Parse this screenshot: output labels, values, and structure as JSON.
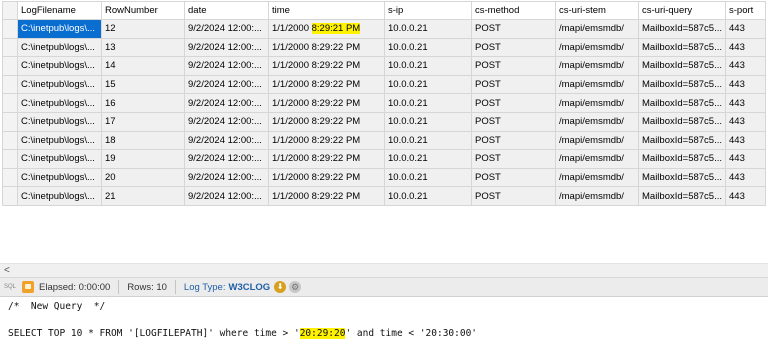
{
  "grid": {
    "columns": [
      "LogFilename",
      "RowNumber",
      "date",
      "time",
      "s-ip",
      "cs-method",
      "cs-uri-stem",
      "cs-uri-query",
      "s-port"
    ],
    "rows": [
      [
        "C:\\inetpub\\logs\\...",
        "12",
        "9/2/2024 12:00:...",
        "1/1/2000",
        "10.0.0.21",
        "POST",
        "/mapi/emsmdb/",
        "MailboxId=587c5...",
        "443"
      ],
      [
        "C:\\inetpub\\logs\\...",
        "13",
        "9/2/2024 12:00:...",
        "1/1/2000 8:29:22 PM",
        "10.0.0.21",
        "POST",
        "/mapi/emsmdb/",
        "MailboxId=587c5...",
        "443"
      ],
      [
        "C:\\inetpub\\logs\\...",
        "14",
        "9/2/2024 12:00:...",
        "1/1/2000 8:29:22 PM",
        "10.0.0.21",
        "POST",
        "/mapi/emsmdb/",
        "MailboxId=587c5...",
        "443"
      ],
      [
        "C:\\inetpub\\logs\\...",
        "15",
        "9/2/2024 12:00:...",
        "1/1/2000 8:29:22 PM",
        "10.0.0.21",
        "POST",
        "/mapi/emsmdb/",
        "MailboxId=587c5...",
        "443"
      ],
      [
        "C:\\inetpub\\logs\\...",
        "16",
        "9/2/2024 12:00:...",
        "1/1/2000 8:29:22 PM",
        "10.0.0.21",
        "POST",
        "/mapi/emsmdb/",
        "MailboxId=587c5...",
        "443"
      ],
      [
        "C:\\inetpub\\logs\\...",
        "17",
        "9/2/2024 12:00:...",
        "1/1/2000 8:29:22 PM",
        "10.0.0.21",
        "POST",
        "/mapi/emsmdb/",
        "MailboxId=587c5...",
        "443"
      ],
      [
        "C:\\inetpub\\logs\\...",
        "18",
        "9/2/2024 12:00:...",
        "1/1/2000 8:29:22 PM",
        "10.0.0.21",
        "POST",
        "/mapi/emsmdb/",
        "MailboxId=587c5...",
        "443"
      ],
      [
        "C:\\inetpub\\logs\\...",
        "19",
        "9/2/2024 12:00:...",
        "1/1/2000 8:29:22 PM",
        "10.0.0.21",
        "POST",
        "/mapi/emsmdb/",
        "MailboxId=587c5...",
        "443"
      ],
      [
        "C:\\inetpub\\logs\\...",
        "20",
        "9/2/2024 12:00:...",
        "1/1/2000 8:29:22 PM",
        "10.0.0.21",
        "POST",
        "/mapi/emsmdb/",
        "MailboxId=587c5...",
        "443"
      ],
      [
        "C:\\inetpub\\logs\\...",
        "21",
        "9/2/2024 12:00:...",
        "1/1/2000 8:29:22 PM",
        "10.0.0.21",
        "POST",
        "/mapi/emsmdb/",
        "MailboxId=587c5...",
        "443"
      ]
    ],
    "first_row_time_highlight": "8:29:21 PM",
    "selected_cell_color": "#0a6ed1",
    "highlight_color": "#fff200"
  },
  "scrollbar": {
    "left_arrow": "<"
  },
  "status": {
    "sql_icon": "sql-icon",
    "elapsed": "Elapsed: 0:00:00",
    "rows": "Rows: 10",
    "log_type_label": "Log Type:",
    "log_type_value": "W3CLOG",
    "down_icon": "download-icon",
    "gear_icon": "gear-icon"
  },
  "editor": {
    "comment": "/*  New Query  */",
    "query_prefix": "SELECT TOP 10 * FROM '[LOGFILEPATH]' where time > '",
    "query_highlight": "20:29:20",
    "query_suffix": "' and time < '20:30:00'"
  }
}
